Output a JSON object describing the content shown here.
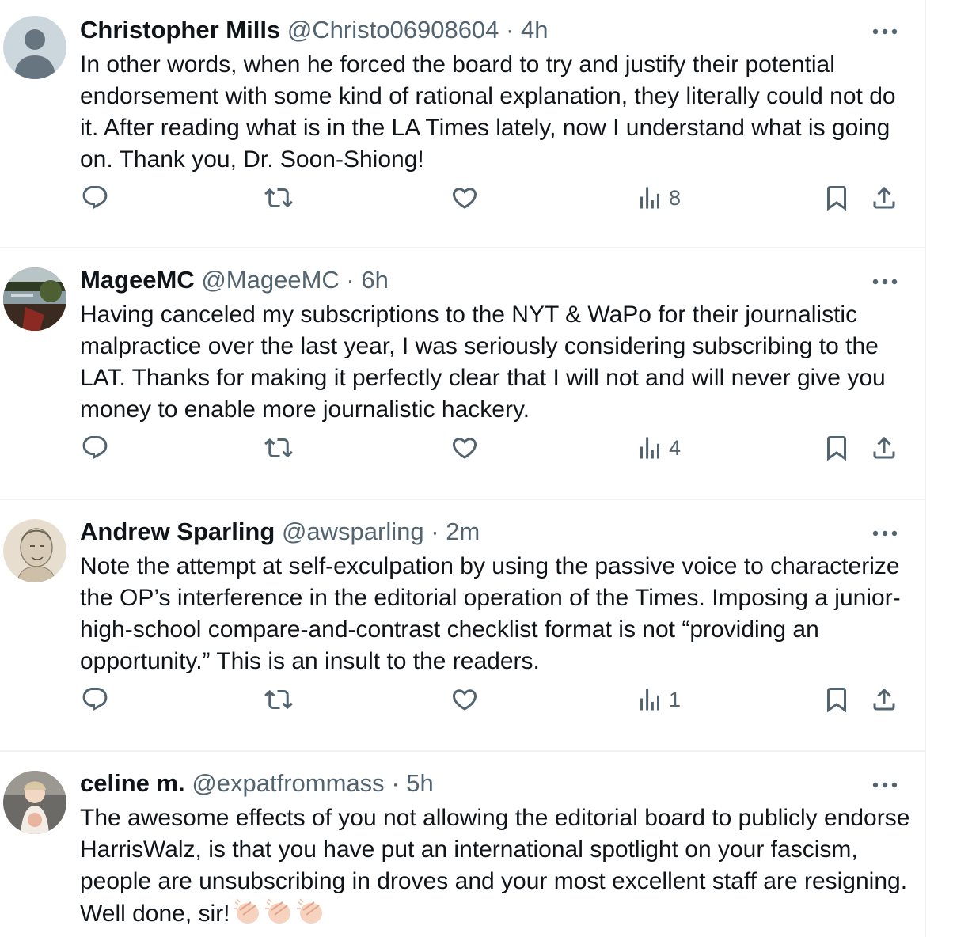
{
  "tweets": [
    {
      "name": "Christopher Mills",
      "handle": "@Christo06908604",
      "separator": "·",
      "time": "4h",
      "text": "In other words, when he forced the board to try and justify their potential endorsement with some kind of rational explanation, they literally could not do it. After reading what is in the LA Times lately, now I understand what is going on. Thank you, Dr. Soon-Shiong!",
      "views": "8"
    },
    {
      "name": "MageeMC",
      "handle": "@MageeMC",
      "separator": "·",
      "time": "6h",
      "text": "Having canceled my subscriptions to the NYT & WaPo for their journalistic malpractice over the last year, I was seriously considering subscribing to the LAT. Thanks for making it perfectly clear that I will not and will never give you money to enable more journalistic hackery.",
      "views": "4"
    },
    {
      "name": "Andrew Sparling",
      "handle": "@awsparling",
      "separator": "·",
      "time": "2m",
      "text": "Note the attempt at self-exculpation by using the passive voice to characterize the OP’s interference in the editorial operation of the Times. Imposing a junior-high-school compare-and-contrast checklist format is not “providing an opportunity.” This is an insult to the readers.",
      "views": "1"
    },
    {
      "name": "celine m.",
      "handle": "@expatfrommass",
      "separator": "·",
      "time": "5h",
      "text": "The awesome effects of you not allowing the editorial board to publicly endorse HarrisWalz, is that you have put an international spotlight on your fascism, people are unsubscribing in droves and your most excellent staff are resigning. Well done, sir!",
      "emoji": [
        "clapping-hands",
        "clapping-hands",
        "clapping-hands"
      ]
    }
  ],
  "icons": {
    "reply": "reply-icon",
    "repost": "repost-icon",
    "like": "like-icon",
    "views": "views-icon",
    "bookmark": "bookmark-icon",
    "share": "share-icon",
    "more": "more-icon"
  },
  "colors": {
    "text": "#0f1419",
    "secondary": "#536471",
    "border": "#eff3f4"
  }
}
